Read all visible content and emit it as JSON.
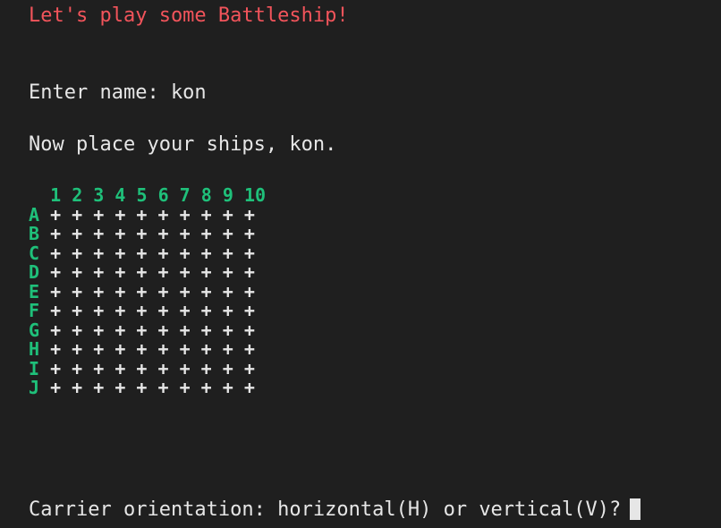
{
  "terminal": {
    "title": "Let's play some Battleship!",
    "name_prompt": "Enter name: kon",
    "place_message": "Now place your ships, kon.",
    "orientation_prompt": "Carrier orientation: horizontal(H) or vertical(V)?"
  },
  "board": {
    "columns": [
      "1",
      "2",
      "3",
      "4",
      "5",
      "6",
      "7",
      "8",
      "9",
      "10"
    ],
    "rows": [
      {
        "label": "A",
        "cells": "+ + + + + + + + + +"
      },
      {
        "label": "B",
        "cells": "+ + + + + + + + + +"
      },
      {
        "label": "C",
        "cells": "+ + + + + + + + + +"
      },
      {
        "label": "D",
        "cells": "+ + + + + + + + + +"
      },
      {
        "label": "E",
        "cells": "+ + + + + + + + + +"
      },
      {
        "label": "F",
        "cells": "+ + + + + + + + + +"
      },
      {
        "label": "G",
        "cells": "+ + + + + + + + + +"
      },
      {
        "label": "H",
        "cells": "+ + + + + + + + + +"
      },
      {
        "label": "I",
        "cells": "+ + + + + + + + + +"
      },
      {
        "label": "J",
        "cells": "+ + + + + + + + + +"
      }
    ]
  },
  "colors": {
    "background": "#1f1f1f",
    "title": "#f2545b",
    "board_labels": "#1fc07a",
    "text": "#e6e6e6"
  }
}
